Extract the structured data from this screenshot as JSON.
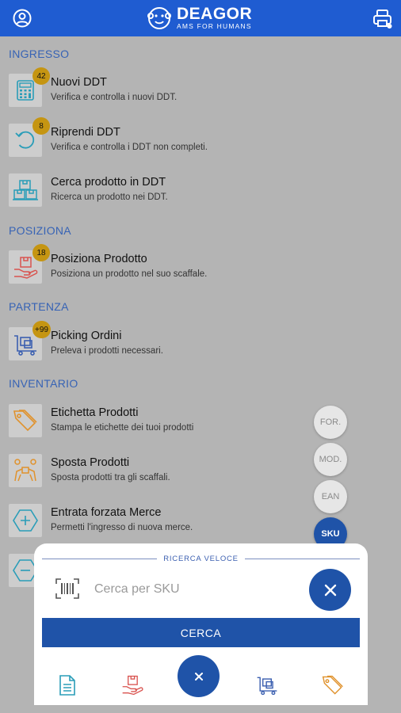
{
  "header": {
    "brand_name": "DEAGOR",
    "brand_tagline": "AMS FOR HUMANS",
    "icons": {
      "left": "user-circle-icon",
      "right": "printer-icon"
    }
  },
  "sections": {
    "ingresso": "INGRESSO",
    "posiziona": "POSIZIONA",
    "partenza": "PARTENZA",
    "inventario": "INVENTARIO"
  },
  "items": [
    {
      "title": "Nuovi DDT",
      "desc": "Verifica e controlla i nuovi DDT.",
      "badge": "42",
      "icon": "calculator-icon"
    },
    {
      "title": "Riprendi DDT",
      "desc": "Verifica e controlla i DDT non completi.",
      "badge": "8",
      "icon": "undo-icon"
    },
    {
      "title": "Cerca prodotto in DDT",
      "desc": "Ricerca un prodotto nei DDT.",
      "badge": "",
      "icon": "boxes-icon"
    },
    {
      "title": "Posiziona Prodotto",
      "desc": "Posiziona un prodotto nel suo scaffale.",
      "badge": "18",
      "icon": "hand-box-icon"
    },
    {
      "title": "Picking Ordini",
      "desc": "Preleva i prodotti necessari.",
      "badge": "+99",
      "icon": "trolley-icon"
    },
    {
      "title": "Etichetta Prodotti",
      "desc": "Stampa le etichette dei tuoi prodotti",
      "badge": "",
      "icon": "tag-icon"
    },
    {
      "title": "Sposta Prodotti",
      "desc": "Sposta prodotti tra gli scaffali.",
      "badge": "",
      "icon": "people-carry-icon"
    },
    {
      "title": "Entrata forzata Merce",
      "desc": "Permetti l'ingresso di nuova merce.",
      "badge": "",
      "icon": "plus-hexagon-icon"
    },
    {
      "title": "",
      "desc": "",
      "badge": "",
      "icon": "minus-hexagon-icon"
    }
  ],
  "quick_filters": [
    "FOR.",
    "MOD.",
    "EAN",
    "SKU"
  ],
  "quick_filter_selected": "SKU",
  "quick_search": {
    "title": "RICERCA VELOCE",
    "placeholder": "Cerca per SKU",
    "value": "",
    "submit_label": "CERCA"
  },
  "bottom_nav": [
    "document-icon",
    "hand-box-icon",
    "close-icon",
    "trolley-icon",
    "tag-icon"
  ],
  "colors": {
    "primary": "#1f5cd1",
    "button": "#1f53a8",
    "badge": "#c59512",
    "section": "#3763b5",
    "icon_teal": "#2a9db8",
    "icon_red": "#d9534f",
    "icon_blue": "#3b5fb0",
    "icon_orange": "#e0922c"
  }
}
